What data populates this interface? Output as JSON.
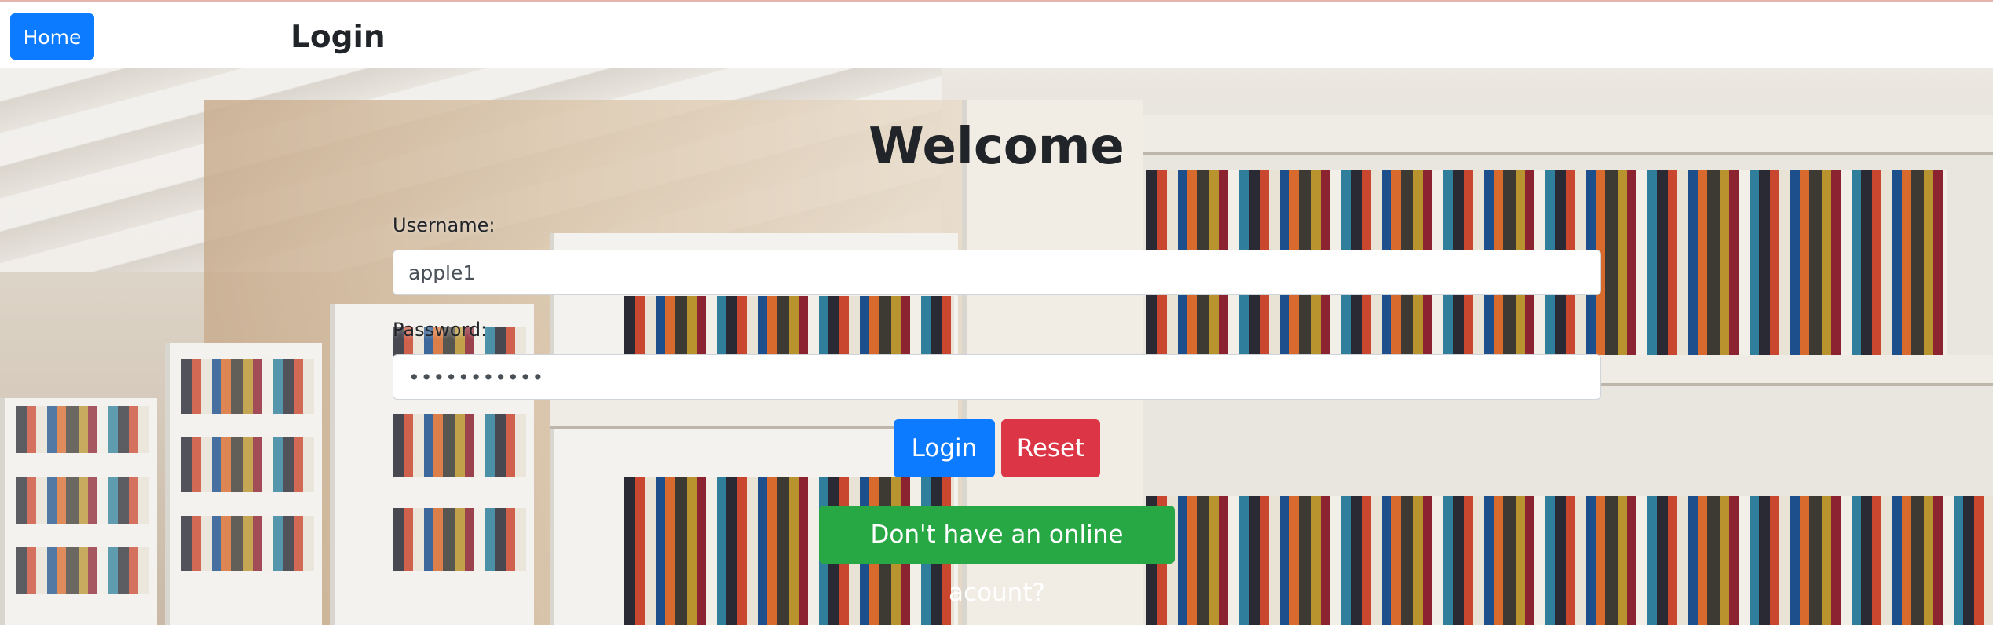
{
  "topbar": {
    "home_label": "Home",
    "title": "Login"
  },
  "main": {
    "heading": "Welcome",
    "username": {
      "label": "Username:",
      "value": "apple1"
    },
    "password": {
      "label": "Password:",
      "value": "•••••••••••"
    },
    "login_label": "Login",
    "reset_label": "Reset",
    "register_label": "Don't have an online acount?"
  },
  "colors": {
    "primary": "#0d7bff",
    "danger": "#dc3545",
    "success": "#28a745"
  }
}
